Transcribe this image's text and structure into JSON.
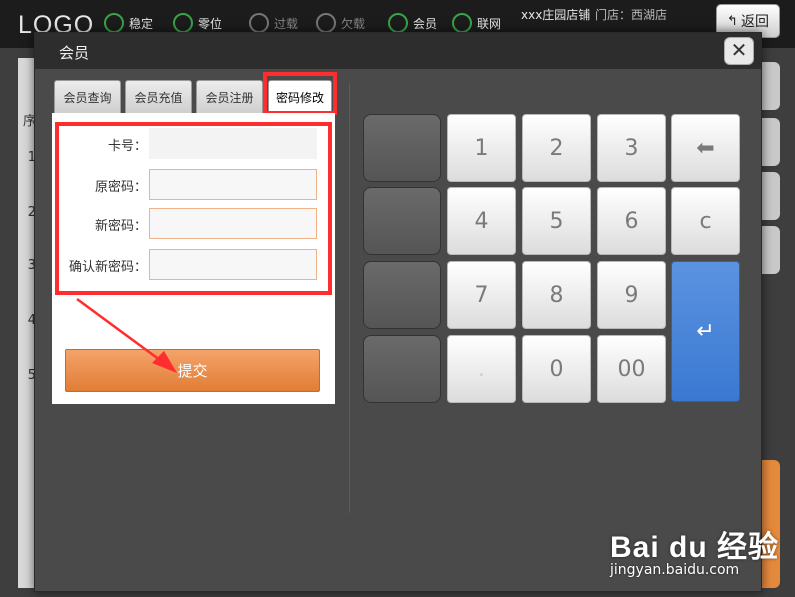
{
  "app": {
    "logo": "LOGO",
    "nav": [
      {
        "label": "稳定",
        "icon": "signal-icon"
      },
      {
        "label": "零位",
        "icon": "scale-icon"
      },
      {
        "label": "过载",
        "icon": "overload-icon"
      },
      {
        "label": "欠载",
        "icon": "underload-icon"
      },
      {
        "label": "会员",
        "icon": "member-icon"
      },
      {
        "label": "联网",
        "icon": "wifi-icon"
      }
    ],
    "shop_name": "xxx庄园店铺",
    "store_label": "门店：西湖店",
    "back_label": "返回",
    "left_rows": [
      "1",
      "2",
      "3",
      "4",
      "5"
    ],
    "left_header": "序"
  },
  "modal": {
    "title": "会员",
    "close_symbol": "✕",
    "tabs": [
      {
        "label": "会员查询"
      },
      {
        "label": "会员充值"
      },
      {
        "label": "会员注册"
      },
      {
        "label": "密码修改"
      }
    ],
    "form": {
      "card_label": "卡号：",
      "card_value": "",
      "old_pw_label": "原密码：",
      "old_pw_value": "",
      "new_pw_label": "新密码：",
      "new_pw_value": "",
      "confirm_pw_label": "确认新密码：",
      "confirm_pw_value": "",
      "submit_label": "提交"
    },
    "keypad": {
      "k1": "1",
      "k2": "2",
      "k3": "3",
      "k4": "4",
      "k5": "5",
      "k6": "6",
      "k7": "7",
      "k8": "8",
      "k9": "9",
      "k0": "0",
      "k00": "00",
      "backspace": "⬅",
      "clear": "c",
      "enter": "↵",
      "dot": "."
    }
  },
  "watermark": {
    "brand": "Bai du 经验",
    "url": "jingyan.baidu.com"
  },
  "colors": {
    "accent_orange": "#e58a3d",
    "enter_blue": "#3a78d2",
    "highlight_red": "#ff2d2d"
  }
}
